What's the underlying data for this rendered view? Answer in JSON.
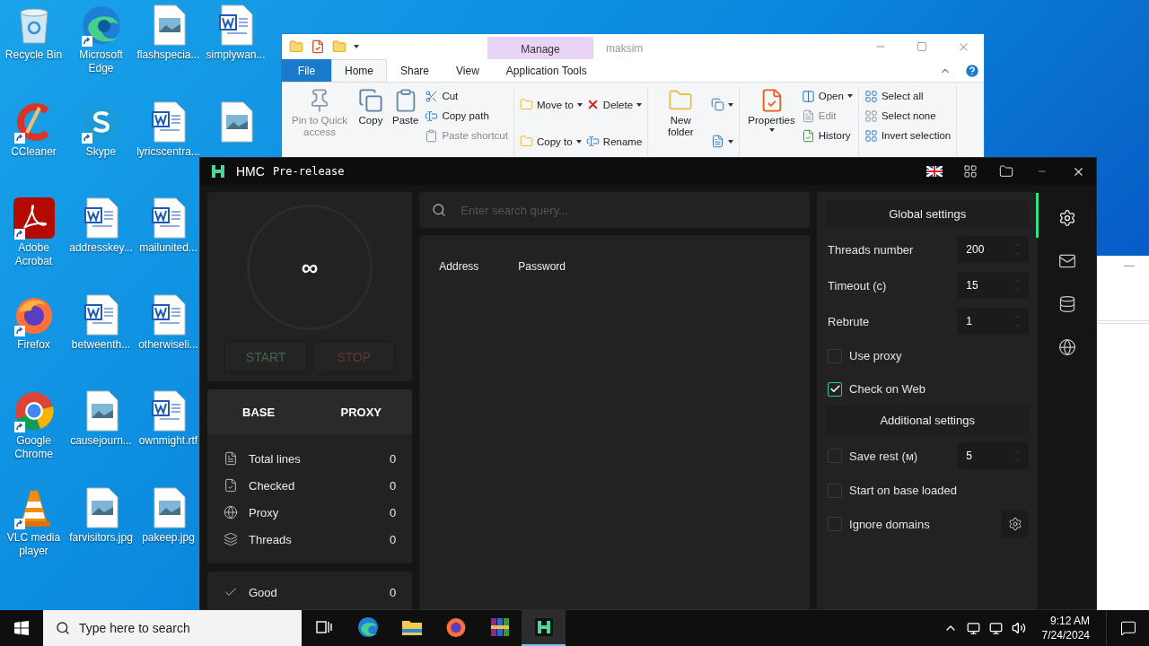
{
  "desktop_icons": [
    {
      "label": "Recycle Bin",
      "kind": "recycle",
      "shortcut": false
    },
    {
      "label": "CCleaner",
      "kind": "ccleaner",
      "shortcut": true
    },
    {
      "label": "Adobe Acrobat",
      "kind": "acrobat",
      "shortcut": true
    },
    {
      "label": "Firefox",
      "kind": "firefox",
      "shortcut": true
    },
    {
      "label": "Google Chrome",
      "kind": "chrome",
      "shortcut": true
    },
    {
      "label": "VLC media player",
      "kind": "vlc",
      "shortcut": true
    },
    {
      "label": "Microsoft Edge",
      "kind": "edge",
      "shortcut": true
    },
    {
      "label": "Skype",
      "kind": "skype",
      "shortcut": true
    },
    {
      "label": "addresskey...",
      "kind": "word",
      "shortcut": false
    },
    {
      "label": "betweenth...",
      "kind": "word",
      "shortcut": false
    },
    {
      "label": "causejourn...",
      "kind": "image",
      "shortcut": false
    },
    {
      "label": "farvisitors.jpg",
      "kind": "image",
      "shortcut": false
    },
    {
      "label": "flashspecia...",
      "kind": "image",
      "shortcut": false
    },
    {
      "label": "lyricscentra...",
      "kind": "word",
      "shortcut": false
    },
    {
      "label": "mailunited...",
      "kind": "word",
      "shortcut": false
    },
    {
      "label": "otherwiseli...",
      "kind": "word",
      "shortcut": false
    },
    {
      "label": "ownmight.rtf",
      "kind": "word",
      "shortcut": false
    },
    {
      "label": "pakeep.jpg",
      "kind": "image",
      "shortcut": false
    },
    {
      "label": "simplywan...",
      "kind": "word",
      "shortcut": false
    },
    {
      "kind": "image",
      "shortcut": false
    }
  ],
  "explorer": {
    "context_tab": "Manage",
    "title": "maksim",
    "tabs": [
      {
        "label": "File",
        "selected": false,
        "kind": "file"
      },
      {
        "label": "Home",
        "selected": true,
        "kind": "tab"
      },
      {
        "label": "Share",
        "selected": false,
        "kind": "tab"
      },
      {
        "label": "View",
        "selected": false,
        "kind": "tab"
      },
      {
        "label": "Application Tools",
        "selected": false,
        "kind": "context"
      }
    ],
    "groups": [
      {
        "items": [
          {
            "kind": "large",
            "label": "Pin to Quick access",
            "disabled": true
          },
          {
            "kind": "large",
            "label": "Copy",
            "disabled": false
          },
          {
            "kind": "large",
            "label": "Paste",
            "disabled": false
          },
          {
            "kind": "column",
            "children": [
              {
                "label": "Cut",
                "disabled": false
              },
              {
                "label": "Copy path",
                "disabled": false
              },
              {
                "label": "Paste shortcut",
                "disabled": true
              }
            ]
          }
        ]
      },
      {
        "items": [
          {
            "kind": "column",
            "children": [
              {
                "label": "Move to",
                "dropdown": true
              },
              {
                "label": "Copy to",
                "dropdown": true
              }
            ]
          },
          {
            "kind": "column",
            "children": [
              {
                "label": "Delete",
                "dropdown": true
              },
              {
                "label": "Rename",
                "dropdown": false
              }
            ]
          }
        ]
      },
      {
        "items": [
          {
            "kind": "large",
            "label": "New folder",
            "dropdown": false
          },
          {
            "kind": "column",
            "children": [
              {
                "dropdown": true
              },
              {
                "dropdown": true
              }
            ]
          }
        ]
      },
      {
        "items": [
          {
            "kind": "large",
            "label": "Properties",
            "dropdown": true
          },
          {
            "kind": "column",
            "children": [
              {
                "label": "Open",
                "dropdown": true,
                "disabled": false
              },
              {
                "label": "Edit",
                "dropdown": false,
                "disabled": true
              },
              {
                "label": "History",
                "dropdown": false,
                "disabled": false
              }
            ]
          }
        ]
      },
      {
        "items": [
          {
            "kind": "column",
            "children": [
              {
                "label": "Select all"
              },
              {
                "label": "Select none"
              },
              {
                "label": "Invert selection"
              }
            ]
          }
        ]
      }
    ]
  },
  "hmc": {
    "title": "HMC",
    "badge": "Pre-release",
    "counter": "∞",
    "start": "START",
    "stop": "STOP",
    "tabs": [
      {
        "label": "BASE"
      },
      {
        "label": "PROXY"
      }
    ],
    "stats": [
      {
        "label": "Total lines",
        "value": "0"
      },
      {
        "label": "Checked",
        "value": "0"
      },
      {
        "label": "Proxy",
        "value": "0"
      },
      {
        "label": "Threads",
        "value": "0"
      }
    ],
    "good": {
      "label": "Good",
      "value": "0"
    },
    "search": {
      "placeholder": "Enter search query..."
    },
    "columns": [
      "Address",
      "Password"
    ],
    "sections": [
      {
        "title": "Global settings",
        "rows": [
          {
            "kind": "spinner",
            "label": "Threads number",
            "value": "200"
          },
          {
            "kind": "spinner",
            "label": "Timeout (c)",
            "value": "15"
          },
          {
            "kind": "spinner",
            "label": "Rebrute",
            "value": "1"
          },
          {
            "kind": "checkbox",
            "label": "Use proxy",
            "checked": false
          },
          {
            "kind": "checkbox",
            "label": "Check on Web",
            "checked": true
          }
        ]
      },
      {
        "title": "Additional settings",
        "rows": [
          {
            "kind": "checkbox_spinner",
            "label": "Save rest (м)",
            "checked": false,
            "value": "5"
          },
          {
            "kind": "checkbox",
            "label": "Start on base loaded",
            "checked": false
          },
          {
            "kind": "checkbox_button",
            "label": "Ignore domains",
            "checked": false
          }
        ]
      }
    ],
    "nav": [
      {
        "selected": true
      },
      {
        "selected": false
      },
      {
        "selected": false
      },
      {
        "selected": false
      }
    ]
  },
  "taskbar": {
    "search": {
      "placeholder": "Type here to search"
    },
    "apps": [
      {
        "active": false
      },
      {
        "active": false
      },
      {
        "active": false
      },
      {
        "active": false
      },
      {
        "active": false
      },
      {
        "active": true
      }
    ],
    "time": "9:12 AM",
    "date": "7/24/2024"
  }
}
